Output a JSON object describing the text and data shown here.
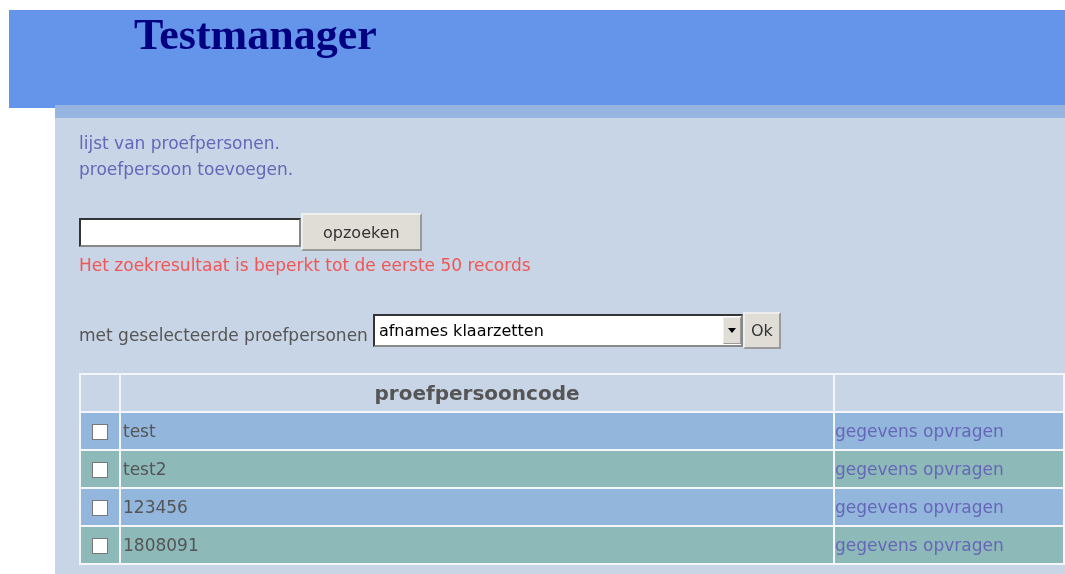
{
  "header": {
    "title": "Testmanager"
  },
  "nav_links": [
    "lijst van proefpersonen.",
    "proefpersoon toevoegen."
  ],
  "search": {
    "button": "opzoeken",
    "notice": "Het zoekresultaat is beperkt tot de eerste 50 records"
  },
  "bulk_action": {
    "label": "met geselecteerde proefpersonen",
    "selected_option": "afnames klaarzetten",
    "button": "Ok"
  },
  "table": {
    "columns": [
      "proefpersooncode"
    ],
    "rows": [
      {
        "checked": false,
        "code": "test",
        "link": "gegevens opvragen"
      },
      {
        "checked": false,
        "code": "test2",
        "link": "gegevens opvragen"
      },
      {
        "checked": false,
        "code": "123456",
        "link": "gegevens opvragen"
      },
      {
        "checked": false,
        "code": "1808091",
        "link": "gegevens opvragen"
      }
    ]
  }
}
